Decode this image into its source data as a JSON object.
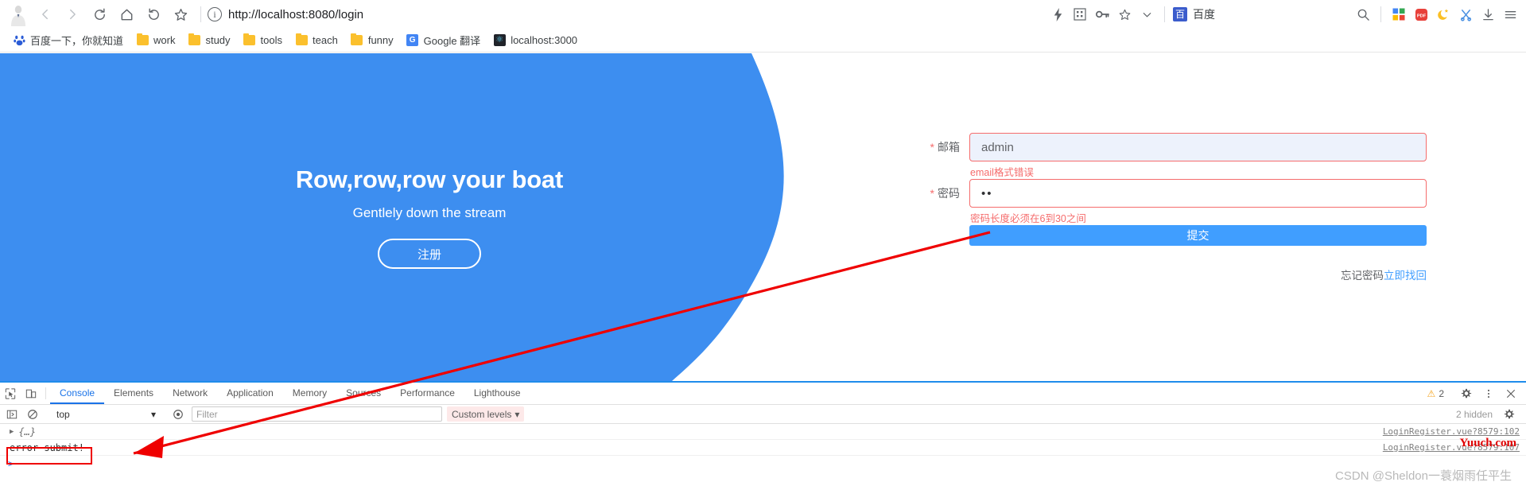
{
  "browser": {
    "url": "http://localhost:8080/login",
    "nav": {
      "back": "back-arrow",
      "forward": "forward-arrow",
      "reload": "reload-icon",
      "home": "home-icon",
      "history": "history-back-icon",
      "bookmark": "star-icon"
    },
    "toolbar_right": [
      {
        "name": "lightning-icon",
        "glyph": "⚡"
      },
      {
        "name": "grid-extension-icon",
        "glyph": "▒"
      },
      {
        "name": "key-icon",
        "glyph": "⚿"
      },
      {
        "name": "star-icon",
        "glyph": "☆"
      },
      {
        "name": "chevron-down-icon",
        "glyph": "∨"
      }
    ],
    "baidu_button": {
      "label": "百度",
      "logo": "百"
    },
    "far_right": [
      {
        "name": "search-icon",
        "glyph": "⚲"
      },
      {
        "name": "apps-grid-icon",
        "glyph": "■"
      },
      {
        "name": "pdf-icon",
        "glyph": "PDF"
      },
      {
        "name": "dark-mode-moon-icon",
        "glyph": "☾"
      },
      {
        "name": "scissors-icon",
        "glyph": "✂"
      },
      {
        "name": "download-icon",
        "glyph": "↓"
      },
      {
        "name": "menu-icon",
        "glyph": "☰"
      }
    ],
    "bookmarks": [
      {
        "label": "百度一下，你就知道",
        "icon": "baidu-favicon"
      },
      {
        "label": "work",
        "icon": "folder-icon"
      },
      {
        "label": "study",
        "icon": "folder-icon"
      },
      {
        "label": "tools",
        "icon": "folder-icon"
      },
      {
        "label": "teach",
        "icon": "folder-icon"
      },
      {
        "label": "funny",
        "icon": "folder-icon"
      },
      {
        "label": "Google 翻译",
        "icon": "google-translate-icon"
      },
      {
        "label": "localhost:3000",
        "icon": "react-favicon"
      }
    ]
  },
  "page": {
    "hero": {
      "title": "Row,row,row your boat",
      "subtitle": "Gentlely down the stream",
      "register_label": "注册"
    },
    "form": {
      "email": {
        "label": "邮箱",
        "value": "admin",
        "error": "email格式错误",
        "required_mark": "*"
      },
      "password": {
        "label": "密码",
        "value": "••",
        "error": "密码长度必须在6到30之间",
        "required_mark": "*"
      },
      "submit_label": "提交",
      "forgot_text": "忘记密码",
      "forgot_link": "立即找回"
    },
    "colors": {
      "brand_blue": "#3d8ef0",
      "button_blue": "#409eff",
      "error_red": "#f56c6c"
    }
  },
  "devtools": {
    "tabs": [
      {
        "label": "Console",
        "active": true
      },
      {
        "label": "Elements",
        "active": false
      },
      {
        "label": "Network",
        "active": false
      },
      {
        "label": "Application",
        "active": false
      },
      {
        "label": "Memory",
        "active": false
      },
      {
        "label": "Sources",
        "active": false
      },
      {
        "label": "Performance",
        "active": false
      },
      {
        "label": "Lighthouse",
        "active": false
      }
    ],
    "warning_count": "2",
    "toolbar": {
      "context": "top",
      "filter_placeholder": "Filter",
      "levels_label": "Custom levels",
      "hidden_label": "2 hidden"
    },
    "console_rows": [
      {
        "expander": "▶",
        "text": "{…}",
        "source": "LoginRegister.vue?8579:102",
        "kind": "object"
      },
      {
        "expander": "",
        "text": "error submit!",
        "source": "LoginRegister.vue?8579:107",
        "kind": "log"
      }
    ],
    "prompt": ">"
  },
  "watermarks": {
    "top": "Yuuch.com",
    "bottom": "CSDN @Sheldon一蓑烟雨任平生"
  }
}
